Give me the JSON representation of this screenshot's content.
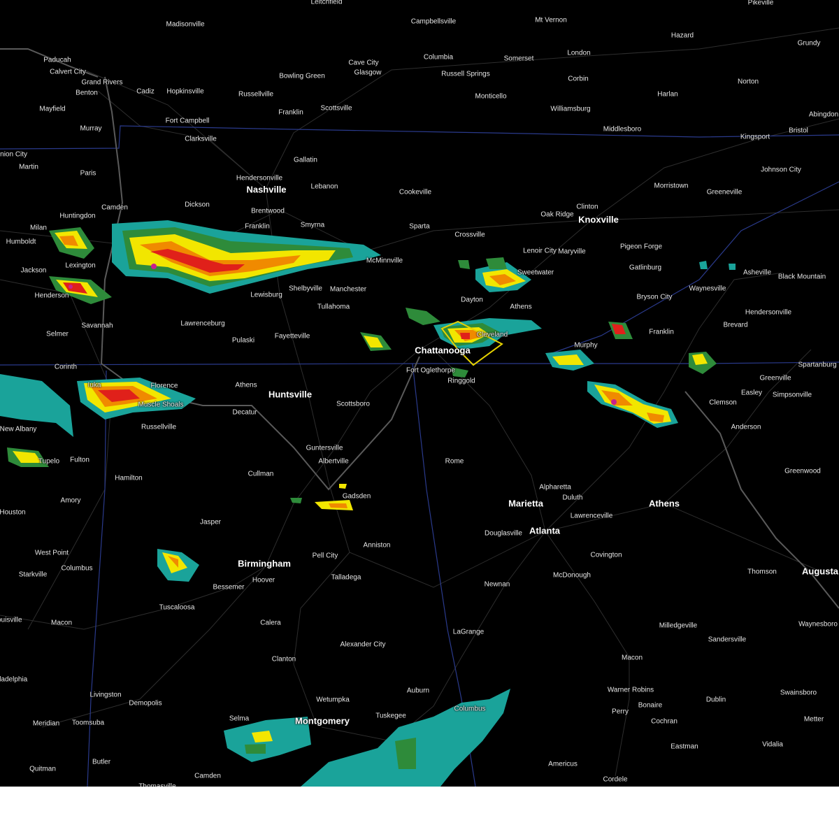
{
  "map": {
    "type": "weather radar reflectivity",
    "colors": {
      "background": "#000000",
      "roads": "#3a3a3a",
      "state_lines": "#2a3a8c",
      "rivers": "#5a5a5a",
      "warning_polygon": "#e6d200",
      "radar_light": "#1aa39a",
      "radar_green": "#2e8b3a",
      "radar_yellow": "#f2e600",
      "radar_orange": "#f08a00",
      "radar_red": "#e0201a",
      "radar_magenta": "#c8208c"
    }
  },
  "cities": [
    {
      "name": "Paducah"
    },
    {
      "name": "Calvert City"
    },
    {
      "name": "Grand Rivers"
    },
    {
      "name": "Benton"
    },
    {
      "name": "Cadiz"
    },
    {
      "name": "Hopkinsville"
    },
    {
      "name": "Russellville"
    },
    {
      "name": "Bowling Green"
    },
    {
      "name": "Glasgow"
    },
    {
      "name": "Cave City"
    },
    {
      "name": "Columbia"
    },
    {
      "name": "Russell Springs"
    },
    {
      "name": "Somerset"
    },
    {
      "name": "London"
    },
    {
      "name": "Corbin"
    },
    {
      "name": "Hazard"
    },
    {
      "name": "Grundy"
    },
    {
      "name": "Pikeville"
    },
    {
      "name": "Leitchfield"
    },
    {
      "name": "Madisonville"
    },
    {
      "name": "Campbellsville"
    },
    {
      "name": "Mt Vernon"
    },
    {
      "name": "Monticello"
    },
    {
      "name": "Williamsburg"
    },
    {
      "name": "Harlan"
    },
    {
      "name": "Norton"
    },
    {
      "name": "Abingdon"
    },
    {
      "name": "Bristol"
    },
    {
      "name": "Kingsport"
    },
    {
      "name": "Middlesboro"
    },
    {
      "name": "Mayfield"
    },
    {
      "name": "Murray"
    },
    {
      "name": "Fort Campbell"
    },
    {
      "name": "Clarksville"
    },
    {
      "name": "Franklin"
    },
    {
      "name": "Scottsville"
    },
    {
      "name": "Gallatin"
    },
    {
      "name": "Hendersonville"
    },
    {
      "name": "Nashville",
      "major": true
    },
    {
      "name": "Lebanon"
    },
    {
      "name": "Brentwood"
    },
    {
      "name": "Franklin"
    },
    {
      "name": "Smyrna"
    },
    {
      "name": "Cookeville"
    },
    {
      "name": "Sparta"
    },
    {
      "name": "Crossville"
    },
    {
      "name": "Oak Ridge"
    },
    {
      "name": "Clinton"
    },
    {
      "name": "Knoxville",
      "major": true
    },
    {
      "name": "Morristown"
    },
    {
      "name": "Greeneville"
    },
    {
      "name": "Johnson City"
    },
    {
      "name": "Lenoir City"
    },
    {
      "name": "Maryville"
    },
    {
      "name": "Pigeon Forge"
    },
    {
      "name": "Gatlinburg"
    },
    {
      "name": "Sweetwater"
    },
    {
      "name": "Dayton"
    },
    {
      "name": "Athens"
    },
    {
      "name": "McMinnville"
    },
    {
      "name": "Manchester"
    },
    {
      "name": "Tullahoma"
    },
    {
      "name": "Shelbyville"
    },
    {
      "name": "Lewisburg"
    },
    {
      "name": "Dickson"
    },
    {
      "name": "Camden"
    },
    {
      "name": "Huntingdon"
    },
    {
      "name": "Paris"
    },
    {
      "name": "Martin"
    },
    {
      "name": "Union City"
    },
    {
      "name": "Humboldt"
    },
    {
      "name": "Milan"
    },
    {
      "name": "Jackson"
    },
    {
      "name": "Lexington"
    },
    {
      "name": "Henderson"
    },
    {
      "name": "Selmer"
    },
    {
      "name": "Savannah"
    },
    {
      "name": "Lawrenceburg"
    },
    {
      "name": "Pulaski"
    },
    {
      "name": "Fayetteville"
    },
    {
      "name": "Chattanooga",
      "major": true
    },
    {
      "name": "Fort Oglethorpe"
    },
    {
      "name": "Ringgold"
    },
    {
      "name": "Cleveland"
    },
    {
      "name": "Murphy"
    },
    {
      "name": "Franklin"
    },
    {
      "name": "Bryson City"
    },
    {
      "name": "Waynesville"
    },
    {
      "name": "Asheville"
    },
    {
      "name": "Black Mountain"
    },
    {
      "name": "Hendersonville"
    },
    {
      "name": "Brevard"
    },
    {
      "name": "Spartanburg"
    },
    {
      "name": "Greenville"
    },
    {
      "name": "Easley"
    },
    {
      "name": "Simpsonville"
    },
    {
      "name": "Clemson"
    },
    {
      "name": "Anderson"
    },
    {
      "name": "Greenwood"
    },
    {
      "name": "Corinth"
    },
    {
      "name": "Iuka"
    },
    {
      "name": "Florence"
    },
    {
      "name": "Muscle Shoals"
    },
    {
      "name": "Athens"
    },
    {
      "name": "Huntsville",
      "major": true
    },
    {
      "name": "Decatur"
    },
    {
      "name": "Scottsboro"
    },
    {
      "name": "New Albany"
    },
    {
      "name": "Russellville"
    },
    {
      "name": "Tupelo"
    },
    {
      "name": "Fulton"
    },
    {
      "name": "Hamilton"
    },
    {
      "name": "Amory"
    },
    {
      "name": "Houston"
    },
    {
      "name": "Guntersville"
    },
    {
      "name": "Albertville"
    },
    {
      "name": "Cullman"
    },
    {
      "name": "Gadsden"
    },
    {
      "name": "Rome"
    },
    {
      "name": "Alpharetta"
    },
    {
      "name": "Duluth"
    },
    {
      "name": "Marietta",
      "major": true
    },
    {
      "name": "Lawrenceville"
    },
    {
      "name": "Athens",
      "major": true
    },
    {
      "name": "Atlanta",
      "major": true
    },
    {
      "name": "Douglasville"
    },
    {
      "name": "Anniston"
    },
    {
      "name": "Jasper"
    },
    {
      "name": "West Point"
    },
    {
      "name": "Starkville"
    },
    {
      "name": "Columbus"
    },
    {
      "name": "Birmingham",
      "major": true
    },
    {
      "name": "Pell City"
    },
    {
      "name": "Hoover"
    },
    {
      "name": "Bessemer"
    },
    {
      "name": "Talladega"
    },
    {
      "name": "Covington"
    },
    {
      "name": "McDonough"
    },
    {
      "name": "Newnan"
    },
    {
      "name": "Thomson"
    },
    {
      "name": "Augusta",
      "major": true
    },
    {
      "name": "Waynesboro"
    },
    {
      "name": "Milledgeville"
    },
    {
      "name": "Sandersville"
    },
    {
      "name": "Tuscaloosa"
    },
    {
      "name": "Macon"
    },
    {
      "name": "Louisville"
    },
    {
      "name": "Calera"
    },
    {
      "name": "Alexander City"
    },
    {
      "name": "LaGrange"
    },
    {
      "name": "Clanton"
    },
    {
      "name": "Macon"
    },
    {
      "name": "Warner Robins"
    },
    {
      "name": "Bonaire"
    },
    {
      "name": "Perry"
    },
    {
      "name": "Swainsboro"
    },
    {
      "name": "Dublin"
    },
    {
      "name": "Philadelphia"
    },
    {
      "name": "Livingston"
    },
    {
      "name": "Demopolis"
    },
    {
      "name": "Wetumpka"
    },
    {
      "name": "Auburn"
    },
    {
      "name": "Columbus"
    },
    {
      "name": "Tuskegee"
    },
    {
      "name": "Montgomery",
      "major": true
    },
    {
      "name": "Selma"
    },
    {
      "name": "Meridian"
    },
    {
      "name": "Toomsuba"
    },
    {
      "name": "Cochran"
    },
    {
      "name": "Metter"
    },
    {
      "name": "Eastman"
    },
    {
      "name": "Vidalia"
    },
    {
      "name": "Americus"
    },
    {
      "name": "Cordele"
    },
    {
      "name": "Butler"
    },
    {
      "name": "Quitman"
    },
    {
      "name": "Camden"
    },
    {
      "name": "Thomasville"
    }
  ]
}
